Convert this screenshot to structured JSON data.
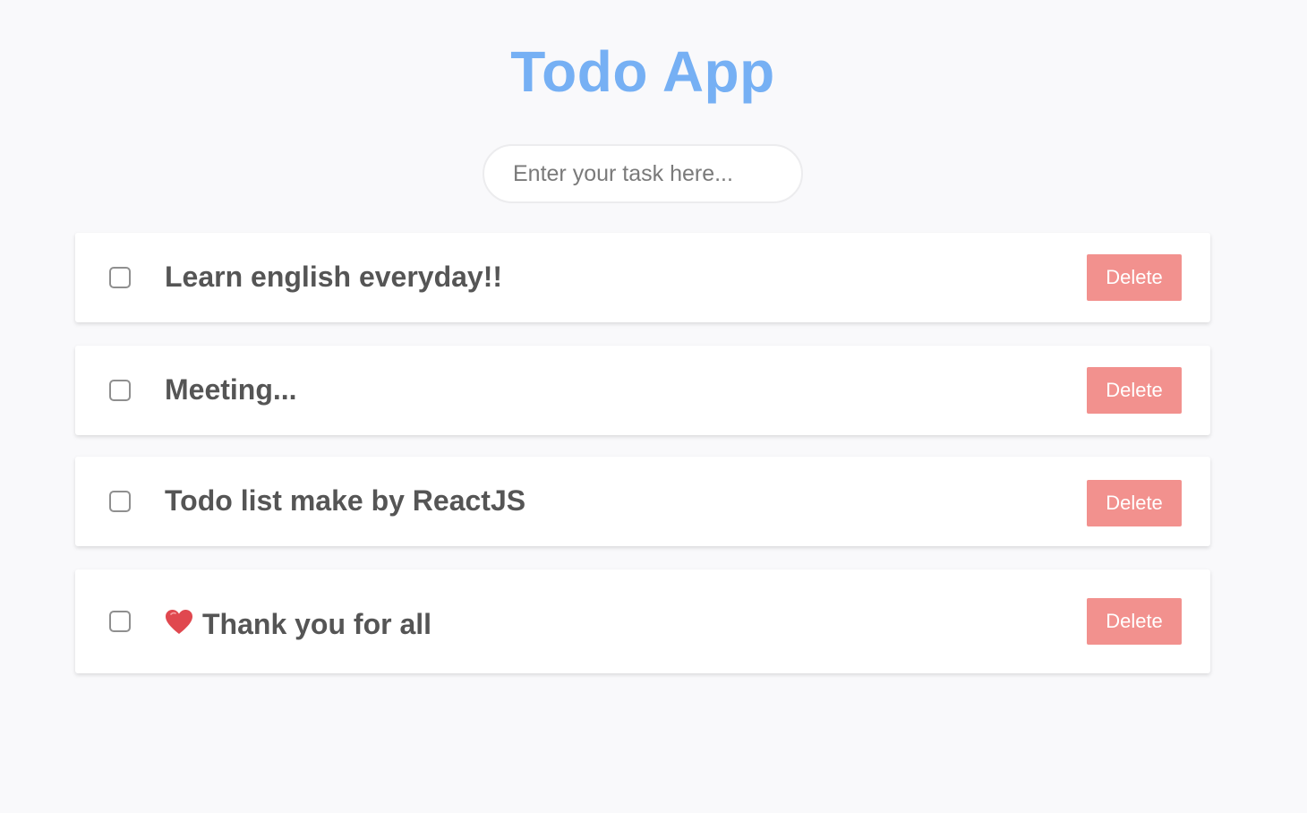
{
  "app": {
    "title": "Todo App"
  },
  "input": {
    "placeholder": "Enter your task here..."
  },
  "todos": [
    {
      "text": "Learn english everyday!!",
      "completed": false,
      "delete_label": "Delete"
    },
    {
      "text": "Meeting...",
      "completed": false,
      "delete_label": "Delete"
    },
    {
      "text": "Todo list make by ReactJS",
      "completed": false,
      "delete_label": "Delete"
    },
    {
      "text": "Thank you for all",
      "icon": "heart-icon",
      "completed": false,
      "delete_label": "Delete"
    }
  ],
  "colors": {
    "title": "#76b0f4",
    "delete_button": "#f2918e",
    "todo_text": "#555555",
    "background": "#f9f9fb",
    "heart": "#e0484f"
  }
}
